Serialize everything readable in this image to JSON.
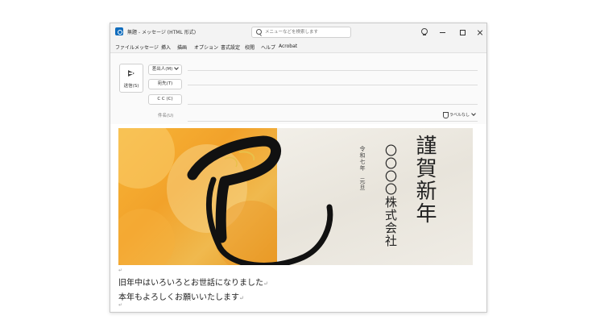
{
  "window": {
    "title": "無題 - メッセージ (HTML 形式)",
    "search_placeholder": "メニューなどを検索します"
  },
  "menu": [
    "ファイル",
    "メッセージ",
    "挿入",
    "描画",
    "オプション",
    "書式設定",
    "校閲",
    "ヘルプ",
    "Acrobat"
  ],
  "compose": {
    "send_label": "送信(S)",
    "from_label": "差出人(M)",
    "to_label": "宛先(T)",
    "cc_label": "C C (C)",
    "subject_label": "件名(U)",
    "sensitivity_label": "ラベルなし"
  },
  "card": {
    "greeting": "謹賀新年",
    "company": "〇〇〇〇株式会社",
    "date": "令和七年　元旦"
  },
  "body": {
    "line1": "旧年中はいろいろとお世話になりました",
    "line2": "本年もよろしくお願いいたします"
  },
  "colors": {
    "accent": "#0f6cbd",
    "banner_orange": "#f2a22a",
    "banner_paper": "#ece8e0"
  }
}
